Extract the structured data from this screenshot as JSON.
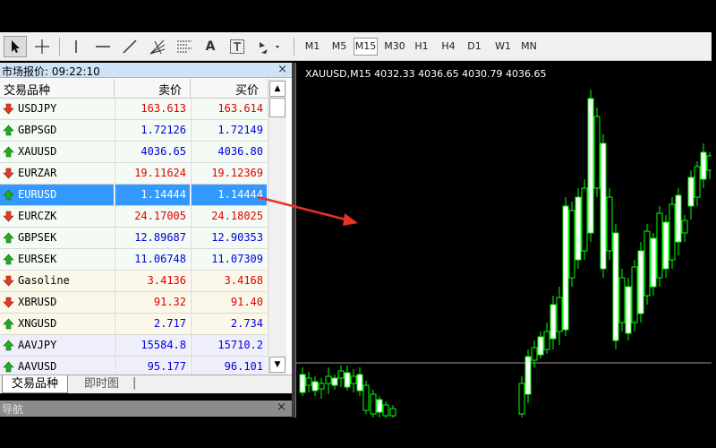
{
  "toolbar": {
    "timeframes": [
      "M1",
      "M5",
      "M15",
      "M30",
      "H1",
      "H4",
      "D1",
      "W1",
      "MN"
    ],
    "active_timeframe": "M15",
    "tools": [
      "cursor-icon",
      "crosshair-icon",
      "vertical-line-icon",
      "horizontal-line-icon",
      "trendline-icon",
      "fibonacci-fan-icon",
      "fibonacci-levels-icon",
      "text-icon",
      "text-label-icon",
      "arrows-icon"
    ],
    "text_tool_label": "A"
  },
  "market_watch": {
    "title": "市场报价: 09:22:10",
    "close_glyph": "×",
    "headers": {
      "symbol": "交易品种",
      "bid": "卖价",
      "ask": "买价"
    },
    "rows": [
      {
        "symbol": "USDJPY",
        "bid": "163.613",
        "ask": "163.614",
        "dir": "down",
        "color": "#e00000",
        "bg": "#f4fbf4"
      },
      {
        "symbol": "GBPSGD",
        "bid": "1.72126",
        "ask": "1.72149",
        "dir": "up",
        "color": "#0000e0",
        "bg": "#f4fbf4"
      },
      {
        "symbol": "XAUUSD",
        "bid": "4036.65",
        "ask": "4036.80",
        "dir": "up",
        "color": "#0000e0",
        "bg": "#f4fbf4"
      },
      {
        "symbol": "EURZAR",
        "bid": "19.11624",
        "ask": "19.12369",
        "dir": "down",
        "color": "#e00000",
        "bg": "#f4fbf4"
      },
      {
        "symbol": "EURUSD",
        "bid": "1.14444",
        "ask": "1.14444",
        "dir": "up",
        "color": "#ffffff",
        "bg": "#3399ff",
        "selected": true
      },
      {
        "symbol": "EURCZK",
        "bid": "24.17005",
        "ask": "24.18025",
        "dir": "down",
        "color": "#e00000",
        "bg": "#f4fbf4"
      },
      {
        "symbol": "GBPSEK",
        "bid": "12.89687",
        "ask": "12.90353",
        "dir": "up",
        "color": "#0000e0",
        "bg": "#f4fbf4"
      },
      {
        "symbol": "EURSEK",
        "bid": "11.06748",
        "ask": "11.07309",
        "dir": "up",
        "color": "#0000e0",
        "bg": "#f4fbf4"
      },
      {
        "symbol": "Gasoline",
        "bid": "3.4136",
        "ask": "3.4168",
        "dir": "down",
        "color": "#e00000",
        "bg": "#fbf8ea"
      },
      {
        "symbol": "XBRUSD",
        "bid": "91.32",
        "ask": "91.40",
        "dir": "down",
        "color": "#e00000",
        "bg": "#fbf8ea"
      },
      {
        "symbol": "XNGUSD",
        "bid": "2.717",
        "ask": "2.734",
        "dir": "up",
        "color": "#0000e0",
        "bg": "#fbf8ea"
      },
      {
        "symbol": "AAVJPY",
        "bid": "15584.8",
        "ask": "15710.2",
        "dir": "up",
        "color": "#0000e0",
        "bg": "#eeeffa"
      },
      {
        "symbol": "AAVUSD",
        "bid": "95.177",
        "ask": "96.101",
        "dir": "up",
        "color": "#0000e0",
        "bg": "#eeeffa"
      }
    ],
    "tabs": [
      "交易品种",
      "即时图"
    ],
    "active_tab": "交易品种"
  },
  "navigator": {
    "title": "导航",
    "close_glyph": "×"
  },
  "chart": {
    "header": "XAUUSD,M15  4032.33 4036.65 4030.79 4036.65",
    "candle_color": "#00ff00",
    "annotation_color": "#e8322a"
  }
}
